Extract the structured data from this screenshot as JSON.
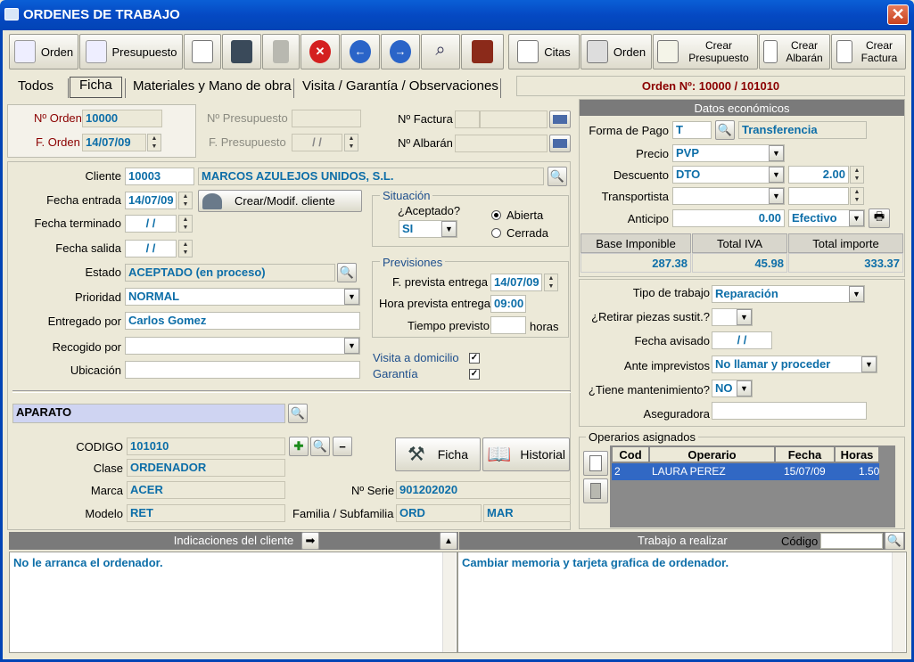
{
  "window": {
    "title": "ORDENES DE TRABAJO"
  },
  "toolbar": {
    "orden": "Orden",
    "presupuesto": "Presupuesto",
    "citas": "Citas",
    "orden2": "Orden",
    "crear_presupuesto": "Crear Presupuesto",
    "crear_albaran": "Crear Albarán",
    "crear_factura": "Crear Factura"
  },
  "tabs": [
    "Todos",
    "Ficha",
    "Materiales y Mano de obra",
    "Visita / Garantía / Observaciones"
  ],
  "orden_num": "Orden Nº: 10000 / 101010",
  "header": {
    "n_orden_label": "Nº Orden",
    "n_orden": "10000",
    "f_orden_label": "F. Orden",
    "f_orden": "14/07/09",
    "n_presupuesto_label": "Nº Presupuesto",
    "f_presupuesto_label": "F. Presupuesto",
    "f_presupuesto": "/ /",
    "n_factura_label": "Nº Factura",
    "n_albaran_label": "Nº Albarán"
  },
  "client": {
    "cliente_label": "Cliente",
    "cliente_code": "10003",
    "cliente_name": "MARCOS AZULEJOS UNIDOS, S.L.",
    "fecha_entrada_label": "Fecha entrada",
    "fecha_entrada": "14/07/09",
    "crear_modif": "Crear/Modif. cliente",
    "fecha_terminado_label": "Fecha terminado",
    "fecha_terminado": "/ /",
    "fecha_salida_label": "Fecha salida",
    "fecha_salida": "/ /",
    "estado_label": "Estado",
    "estado": "ACEPTADO (en proceso)",
    "prioridad_label": "Prioridad",
    "prioridad": "NORMAL",
    "entregado_label": "Entregado por",
    "entregado": "Carlos Gomez",
    "recogido_label": "Recogido por",
    "recogido": "",
    "ubicacion_label": "Ubicación",
    "ubicacion": ""
  },
  "situacion": {
    "title": "Situación",
    "aceptado_label": "¿Aceptado?",
    "aceptado": "SI",
    "abierta": "Abierta",
    "cerrada": "Cerrada"
  },
  "previsiones": {
    "title": "Previsiones",
    "f_prevista_label": "F. prevista entrega",
    "f_prevista": "14/07/09",
    "hora_label": "Hora prevista entrega",
    "hora": "09:00",
    "tiempo_label": "Tiempo previsto",
    "tiempo_unit": "horas"
  },
  "visita_label": "Visita a domicilio",
  "garantia_label": "Garantía",
  "aparato": {
    "title": "APARATO",
    "codigo_label": "CODIGO",
    "codigo": "101010",
    "clase_label": "Clase",
    "clase": "ORDENADOR",
    "marca_label": "Marca",
    "marca": "ACER",
    "modelo_label": "Modelo",
    "modelo": "RET",
    "serie_label": "Nº Serie",
    "serie": "901202020",
    "familia_label": "Familia / Subfamilia",
    "familia": "ORD",
    "subfamilia": "MAR",
    "ficha": "Ficha",
    "historial": "Historial"
  },
  "economicos": {
    "title": "Datos económicos",
    "forma_pago_label": "Forma de Pago",
    "forma_pago_code": "T",
    "forma_pago": "Transferencia",
    "precio_label": "Precio",
    "precio": "PVP",
    "descuento_label": "Descuento",
    "descuento": "DTO",
    "descuento_val": "2.00",
    "transportista_label": "Transportista",
    "anticipo_label": "Anticipo",
    "anticipo": "0.00",
    "anticipo_tipo": "Efectivo",
    "base_label": "Base Imponible",
    "iva_label": "Total IVA",
    "total_label": "Total importe",
    "base": "287.38",
    "iva": "45.98",
    "total": "333.37"
  },
  "trabajo": {
    "tipo_label": "Tipo de trabajo",
    "tipo": "Reparación",
    "retirar_label": "¿Retirar piezas sustit.?",
    "retirar": "",
    "fecha_avisado_label": "Fecha avisado",
    "fecha_avisado": "/ /",
    "ante_label": "Ante imprevistos",
    "ante": "No llamar y proceder",
    "mant_label": "¿Tiene mantenimiento?",
    "mant": "NO",
    "aseg_label": "Aseguradora",
    "aseg": ""
  },
  "operarios": {
    "title": "Operarios asignados",
    "cols": [
      "Cod",
      "Operario",
      "Fecha",
      "Horas"
    ],
    "rows": [
      [
        "2",
        "LAURA PEREZ",
        "15/07/09",
        "1.50"
      ]
    ]
  },
  "indicaciones": {
    "title": "Indicaciones del cliente",
    "text": "No le arranca el ordenador."
  },
  "trabajo_realizar": {
    "title": "Trabajo a realizar",
    "codigo_label": "Código",
    "text": "Cambiar memoria y tarjeta grafica de ordenador."
  }
}
